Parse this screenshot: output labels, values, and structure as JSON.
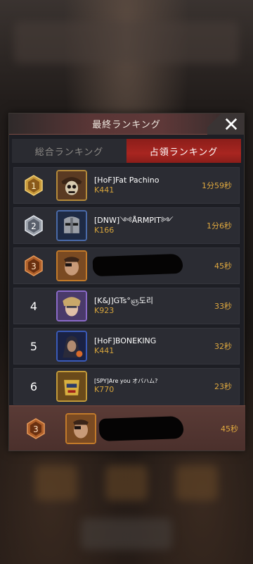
{
  "panel": {
    "title": "最終ランキング",
    "close_icon": "close-x-icon"
  },
  "tabs": [
    {
      "label": "総合ランキング",
      "active": false
    },
    {
      "label": "占領ランキング",
      "active": true
    }
  ],
  "rankings": [
    {
      "rank": "1",
      "medal": "gold",
      "name": "[HoF]Fat Pachino",
      "kingdom": "K441",
      "time": "1分59秒",
      "avatar": "skull-pirate-avatar"
    },
    {
      "rank": "2",
      "medal": "silver",
      "name": "[DNW]༺ÅRMPIT༻",
      "kingdom": "K166",
      "time": "1分6秒",
      "avatar": "knight-helmet-avatar"
    },
    {
      "rank": "3",
      "medal": "bronze",
      "name": "",
      "kingdom": "",
      "time": "45秒",
      "avatar": "eyepatch-hero-avatar"
    },
    {
      "rank": "4",
      "medal": "",
      "name": "[K&J]GTs°ஞ도리",
      "kingdom": "K923",
      "time": "33秒",
      "avatar": "helmet-blonde-avatar"
    },
    {
      "rank": "5",
      "medal": "",
      "name": "[HoF]BONEKING",
      "kingdom": "K441",
      "time": "32秒",
      "avatar": "dark-mage-avatar"
    },
    {
      "rank": "6",
      "medal": "",
      "name": "[SPY]Are you オバハム?",
      "kingdom": "K770",
      "time": "23秒",
      "avatar": "golden-robot-avatar"
    }
  ],
  "my_rank": {
    "rank": "3",
    "medal": "bronze",
    "name": "",
    "kingdom": "",
    "time": "45秒",
    "avatar": "eyepatch-hero-avatar"
  },
  "colors": {
    "accent_red": "#a82520",
    "kingdom_gold": "#d6a43c",
    "time_gold": "#e0a93f"
  }
}
